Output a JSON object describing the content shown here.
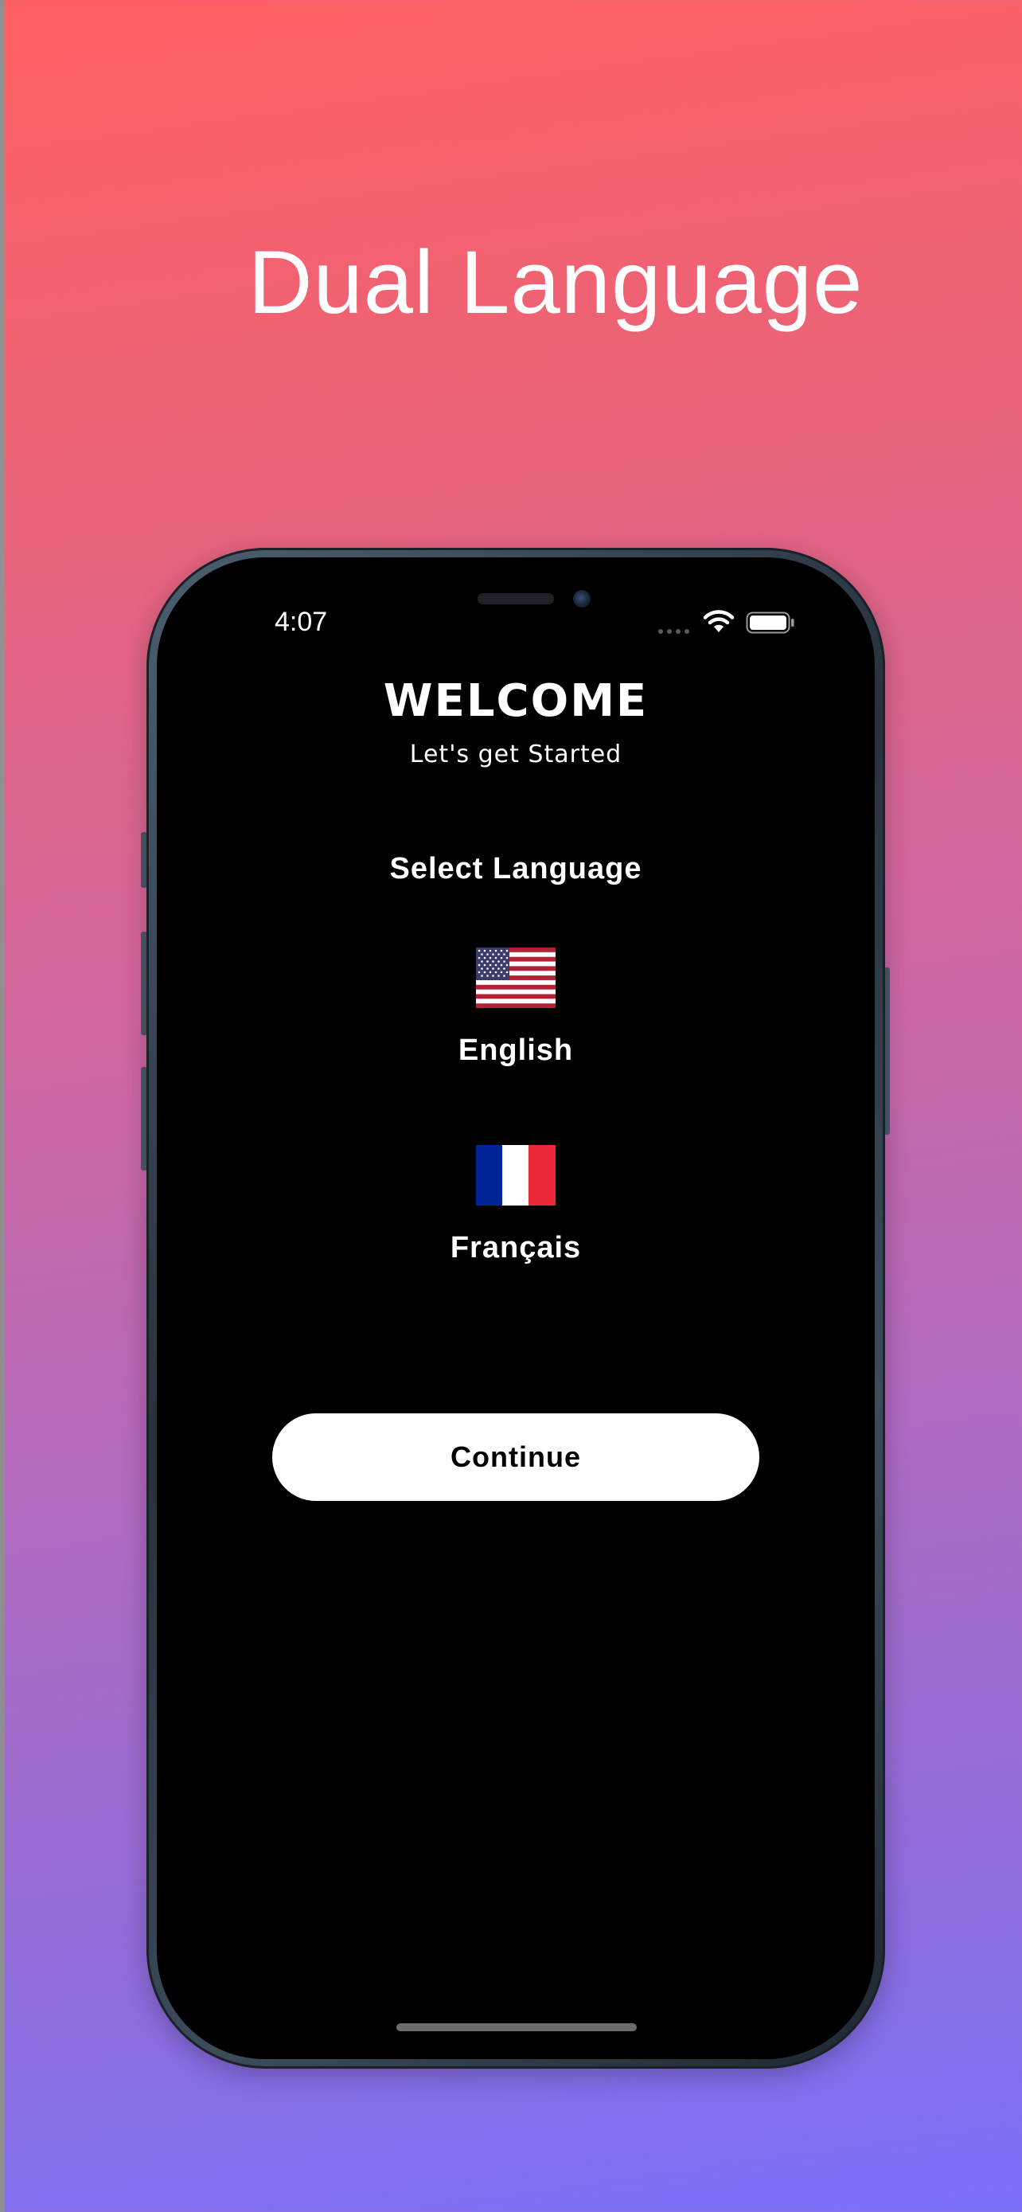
{
  "promo": {
    "headline": "Dual Language"
  },
  "status_bar": {
    "time": "4:07",
    "icons": [
      "cellular-signal-icon",
      "wifi-icon",
      "battery-icon"
    ]
  },
  "screen": {
    "title": "WELCOME",
    "subtitle": "Let's get Started",
    "section_label": "Select Language",
    "languages": [
      {
        "label": "English",
        "flag": "us-flag-icon"
      },
      {
        "label": "Français",
        "flag": "france-flag-icon"
      }
    ],
    "continue_label": "Continue"
  },
  "colors": {
    "gradient_top": "#ff5f60",
    "gradient_bottom": "#786ff8",
    "screen_background": "#000000",
    "button_background": "#ffffff",
    "us_blue": "#3c3b6e",
    "us_red": "#b22234",
    "fr_blue": "#002395",
    "fr_red": "#ed2939"
  }
}
